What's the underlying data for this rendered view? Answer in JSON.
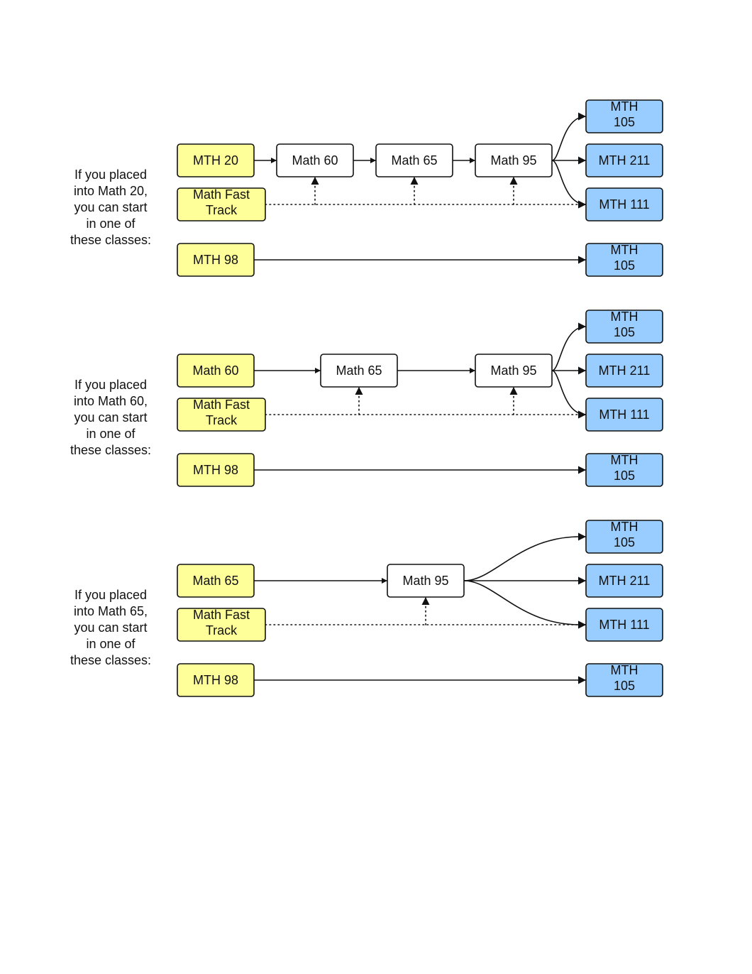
{
  "colors": {
    "start": "#ffff99",
    "intermediate": "#ffffff",
    "target": "#99ccff",
    "border": "#111111",
    "text": "#111111"
  },
  "sections": [
    {
      "caption": [
        "If you placed",
        "into Math 20,",
        "you can start",
        "in one of",
        "these classes:"
      ],
      "nodes": [
        {
          "id": "mth20",
          "label": [
            "MTH 20"
          ],
          "kind": "start"
        },
        {
          "id": "fast",
          "label": [
            "Math Fast",
            "Track"
          ],
          "kind": "start"
        },
        {
          "id": "mth98",
          "label": [
            "MTH 98"
          ],
          "kind": "start"
        },
        {
          "id": "m60",
          "label": [
            "Math 60"
          ],
          "kind": "intermediate"
        },
        {
          "id": "m65",
          "label": [
            "Math 65"
          ],
          "kind": "intermediate"
        },
        {
          "id": "m95",
          "label": [
            "Math 95"
          ],
          "kind": "intermediate"
        },
        {
          "id": "t105a",
          "label": [
            "MTH",
            "105"
          ],
          "kind": "target"
        },
        {
          "id": "t211",
          "label": [
            "MTH 211"
          ],
          "kind": "target"
        },
        {
          "id": "t111",
          "label": [
            "MTH 111"
          ],
          "kind": "target"
        },
        {
          "id": "t105b",
          "label": [
            "MTH",
            "105"
          ],
          "kind": "target"
        }
      ],
      "edges": [
        {
          "from": "mth20",
          "to": "m60",
          "style": "solid"
        },
        {
          "from": "m60",
          "to": "m65",
          "style": "solid"
        },
        {
          "from": "m65",
          "to": "m95",
          "style": "solid"
        },
        {
          "from": "m95",
          "to": "t105a",
          "style": "solid"
        },
        {
          "from": "m95",
          "to": "t211",
          "style": "solid"
        },
        {
          "from": "m95",
          "to": "t111",
          "style": "solid"
        },
        {
          "from": "fast",
          "to": "m60",
          "style": "dotted"
        },
        {
          "from": "fast",
          "to": "m65",
          "style": "dotted"
        },
        {
          "from": "fast",
          "to": "m95",
          "style": "dotted"
        },
        {
          "from": "fast",
          "to": "t111",
          "style": "dotted"
        },
        {
          "from": "mth98",
          "to": "t105b",
          "style": "solid"
        }
      ]
    },
    {
      "caption": [
        "If you placed",
        "into Math 60,",
        "you can start",
        "in one of",
        "these classes:"
      ],
      "nodes": [
        {
          "id": "m60s",
          "label": [
            "Math 60"
          ],
          "kind": "start"
        },
        {
          "id": "fast",
          "label": [
            "Math Fast",
            "Track"
          ],
          "kind": "start"
        },
        {
          "id": "mth98",
          "label": [
            "MTH 98"
          ],
          "kind": "start"
        },
        {
          "id": "m65",
          "label": [
            "Math 65"
          ],
          "kind": "intermediate"
        },
        {
          "id": "m95",
          "label": [
            "Math 95"
          ],
          "kind": "intermediate"
        },
        {
          "id": "t105a",
          "label": [
            "MTH",
            "105"
          ],
          "kind": "target"
        },
        {
          "id": "t211",
          "label": [
            "MTH 211"
          ],
          "kind": "target"
        },
        {
          "id": "t111",
          "label": [
            "MTH 111"
          ],
          "kind": "target"
        },
        {
          "id": "t105b",
          "label": [
            "MTH",
            "105"
          ],
          "kind": "target"
        }
      ],
      "edges": [
        {
          "from": "m60s",
          "to": "m65",
          "style": "solid"
        },
        {
          "from": "m65",
          "to": "m95",
          "style": "solid"
        },
        {
          "from": "m95",
          "to": "t105a",
          "style": "solid"
        },
        {
          "from": "m95",
          "to": "t211",
          "style": "solid"
        },
        {
          "from": "m95",
          "to": "t111",
          "style": "solid"
        },
        {
          "from": "fast",
          "to": "m65",
          "style": "dotted"
        },
        {
          "from": "fast",
          "to": "m95",
          "style": "dotted"
        },
        {
          "from": "fast",
          "to": "t111",
          "style": "dotted"
        },
        {
          "from": "mth98",
          "to": "t105b",
          "style": "solid"
        }
      ]
    },
    {
      "caption": [
        "If you placed",
        "into Math 65,",
        "you can start",
        "in one of",
        "these classes:"
      ],
      "nodes": [
        {
          "id": "m65s",
          "label": [
            "Math 65"
          ],
          "kind": "start"
        },
        {
          "id": "fast",
          "label": [
            "Math Fast",
            "Track"
          ],
          "kind": "start"
        },
        {
          "id": "mth98",
          "label": [
            "MTH 98"
          ],
          "kind": "start"
        },
        {
          "id": "m95",
          "label": [
            "Math 95"
          ],
          "kind": "intermediate"
        },
        {
          "id": "t105a",
          "label": [
            "MTH",
            "105"
          ],
          "kind": "target"
        },
        {
          "id": "t211",
          "label": [
            "MTH 211"
          ],
          "kind": "target"
        },
        {
          "id": "t111",
          "label": [
            "MTH 111"
          ],
          "kind": "target"
        },
        {
          "id": "t105b",
          "label": [
            "MTH",
            "105"
          ],
          "kind": "target"
        }
      ],
      "edges": [
        {
          "from": "m65s",
          "to": "m95",
          "style": "solid"
        },
        {
          "from": "m95",
          "to": "t105a",
          "style": "solid"
        },
        {
          "from": "m95",
          "to": "t211",
          "style": "solid"
        },
        {
          "from": "m95",
          "to": "t111",
          "style": "solid"
        },
        {
          "from": "fast",
          "to": "m95",
          "style": "dotted"
        },
        {
          "from": "fast",
          "to": "t111",
          "style": "dotted"
        },
        {
          "from": "mth98",
          "to": "t105b",
          "style": "solid"
        }
      ]
    }
  ]
}
